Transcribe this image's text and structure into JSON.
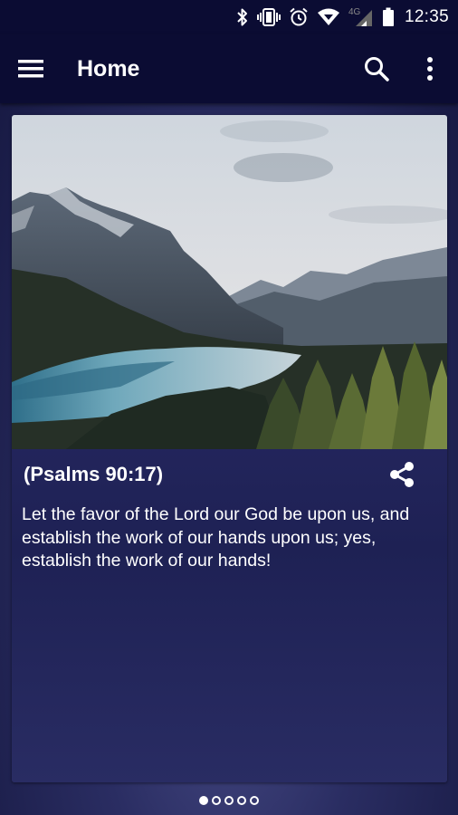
{
  "status_bar": {
    "time": "12:35",
    "network": "4G",
    "icons": [
      "bluetooth-icon",
      "vibrate-icon",
      "alarm-icon",
      "wifi-icon",
      "signal-icon",
      "battery-icon"
    ]
  },
  "app_bar": {
    "title": "Home",
    "icons": [
      "menu-icon",
      "search-icon",
      "more-vert-icon"
    ]
  },
  "verse_card": {
    "reference": "(Psalms 90:17)",
    "text": "Let the favor of the Lord our God be upon us, and establish the work of our hands upon us; yes, establish the work of our hands!",
    "share_icon": "share-icon",
    "image": "mountain-lake-landscape"
  },
  "pager": {
    "count": 5,
    "active_index": 0
  },
  "colors": {
    "app_bar": "#0b0c33",
    "card": "#252760",
    "text": "#ffffff"
  }
}
